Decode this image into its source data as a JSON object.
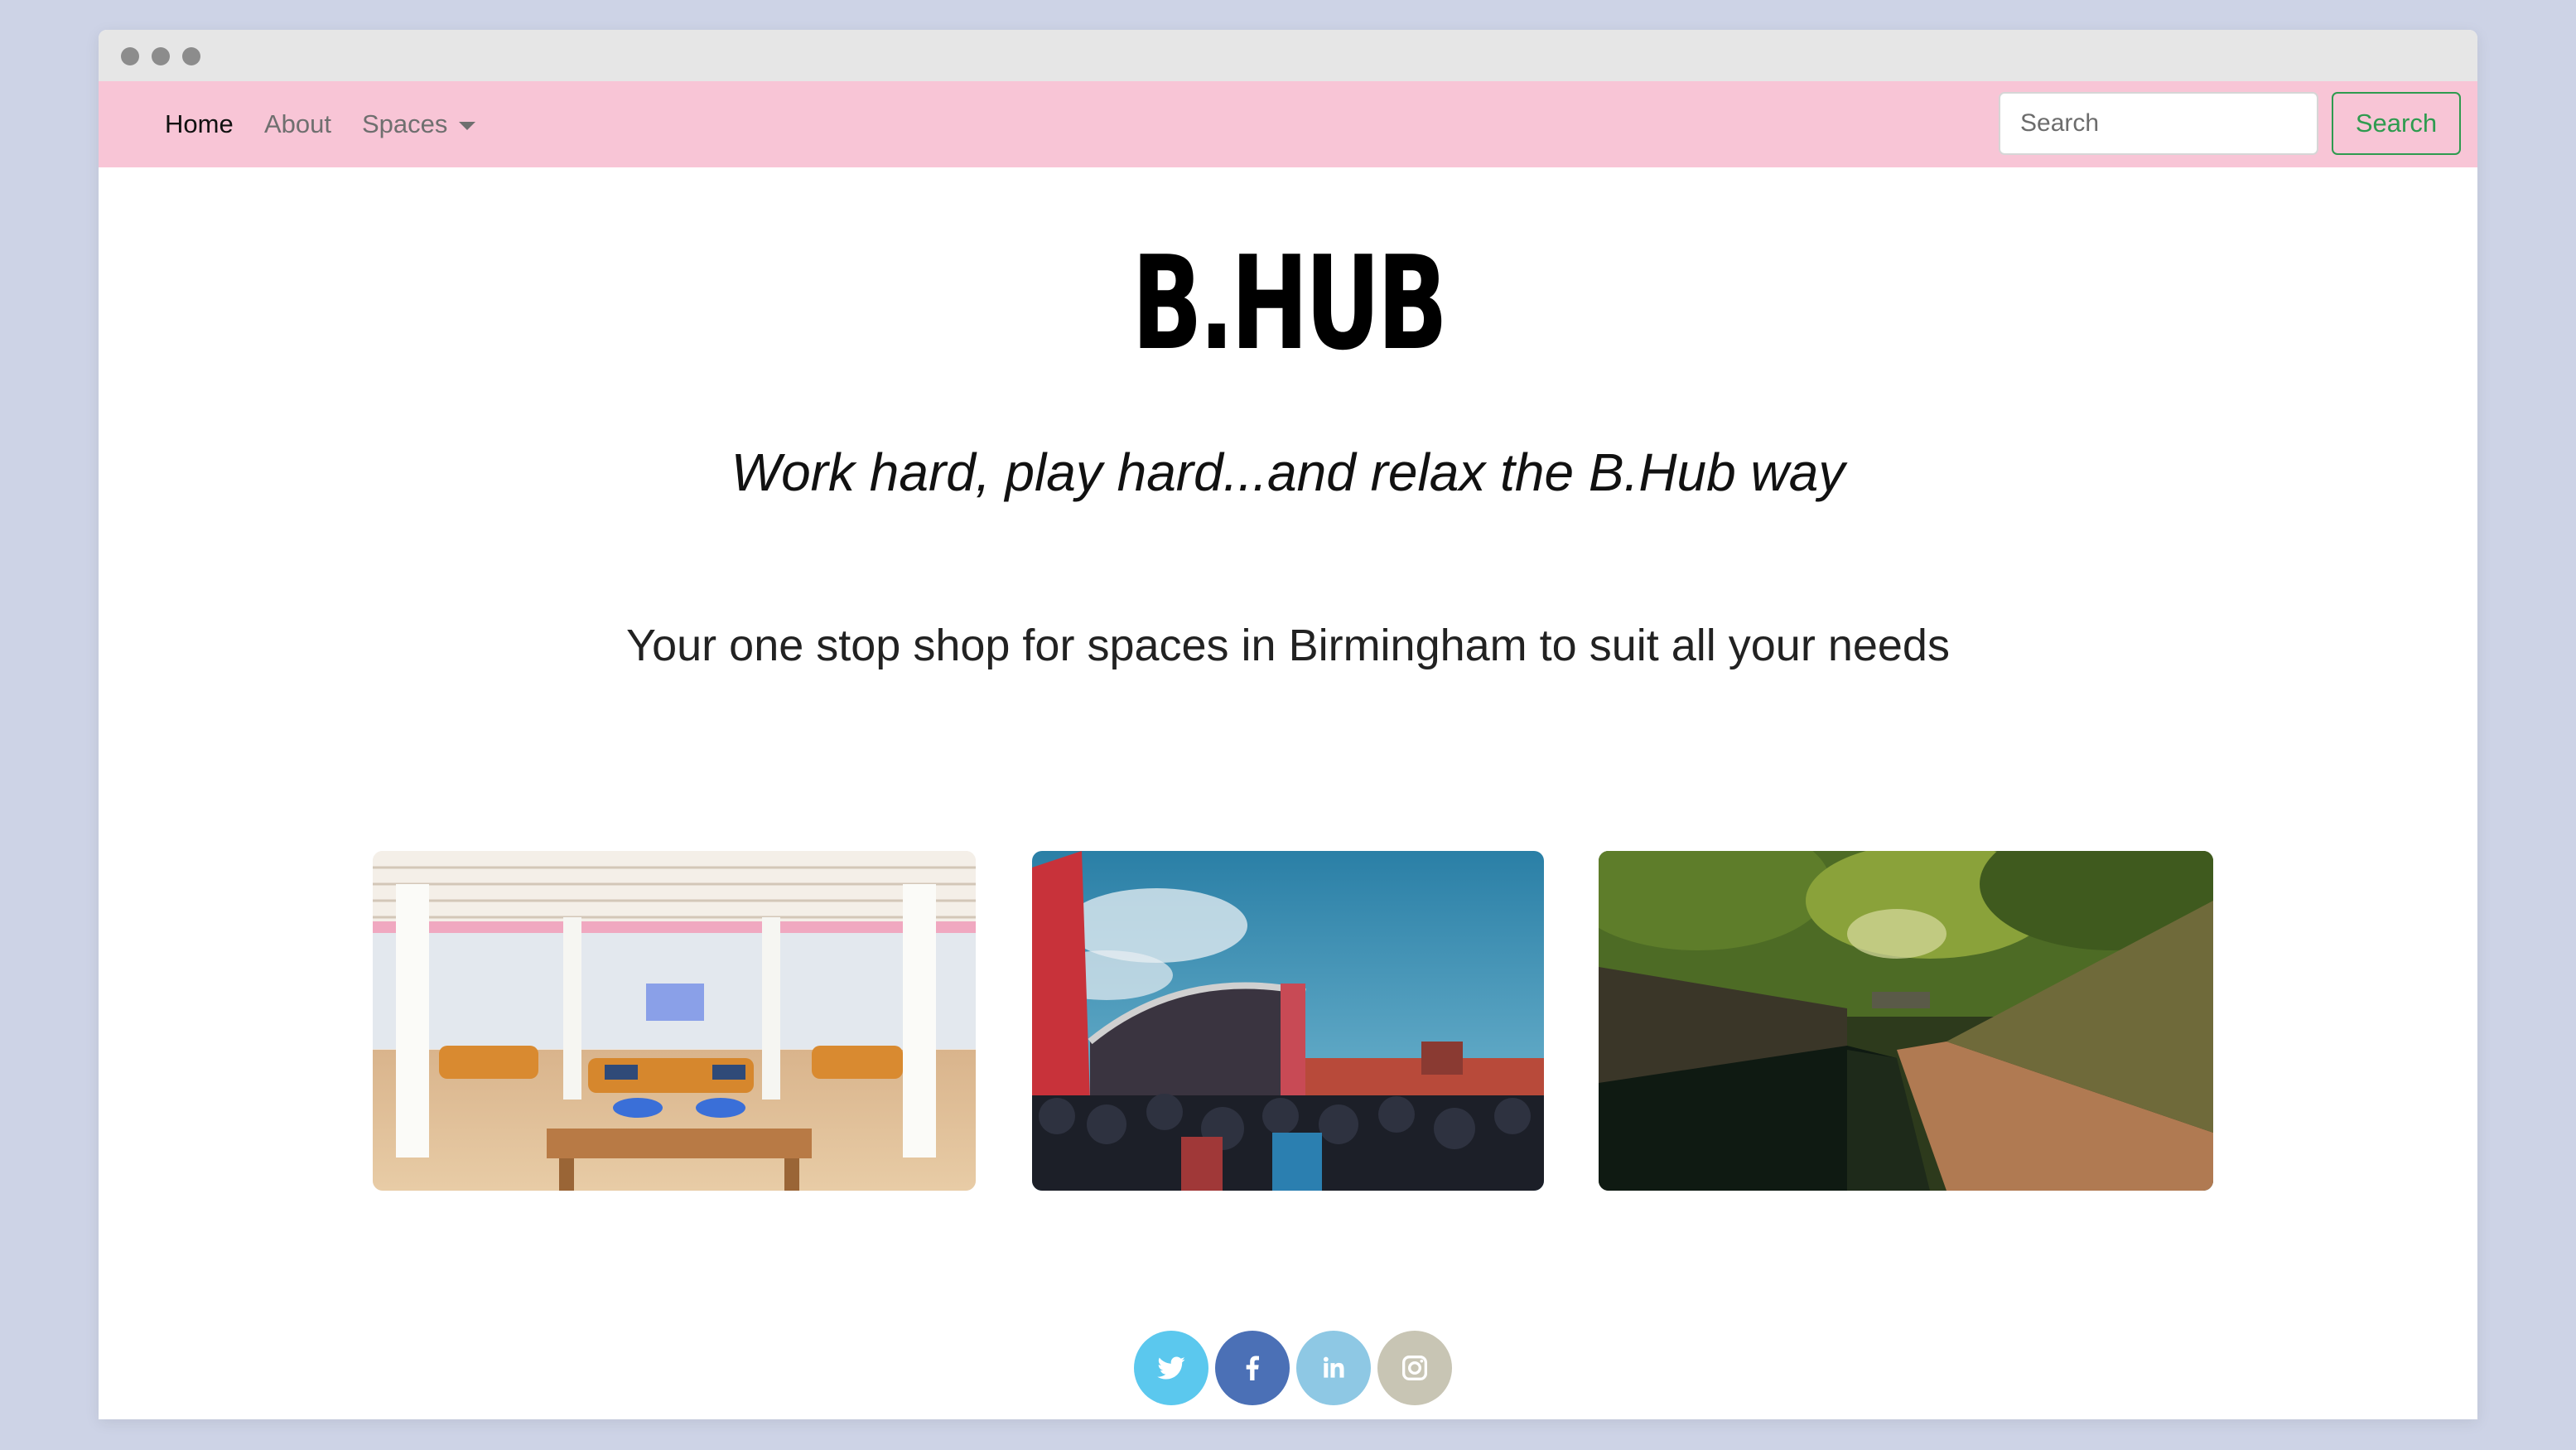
{
  "nav": {
    "items": [
      {
        "label": "Home",
        "active": true
      },
      {
        "label": "About",
        "active": false
      },
      {
        "label": "Spaces",
        "active": false
      }
    ],
    "search_placeholder": "Search",
    "search_button": "Search"
  },
  "hero": {
    "logo": "B.HUB",
    "tagline": "Work hard, play hard...and relax the B.Hub way",
    "subtitle": "Your one stop shop for spaces in Birmingham to suit all your needs"
  },
  "gallery": [
    {
      "subject": "coworking lounge interior"
    },
    {
      "subject": "outdoor festival stage with crowd"
    },
    {
      "subject": "canal towpath with trees"
    }
  ],
  "social": [
    {
      "network": "twitter",
      "icon": "twitter-icon",
      "color": "#5bc8ee"
    },
    {
      "network": "facebook",
      "icon": "facebook-icon",
      "color": "#4b70b6"
    },
    {
      "network": "linkedin",
      "icon": "linkedin-icon",
      "color": "#8ec8e4"
    },
    {
      "network": "instagram",
      "icon": "instagram-icon",
      "color": "#c8c5b4"
    }
  ],
  "colors": {
    "navbar": "#f8c5d6",
    "search_button": "#2e9b4f",
    "background": "#cdd3e6"
  }
}
